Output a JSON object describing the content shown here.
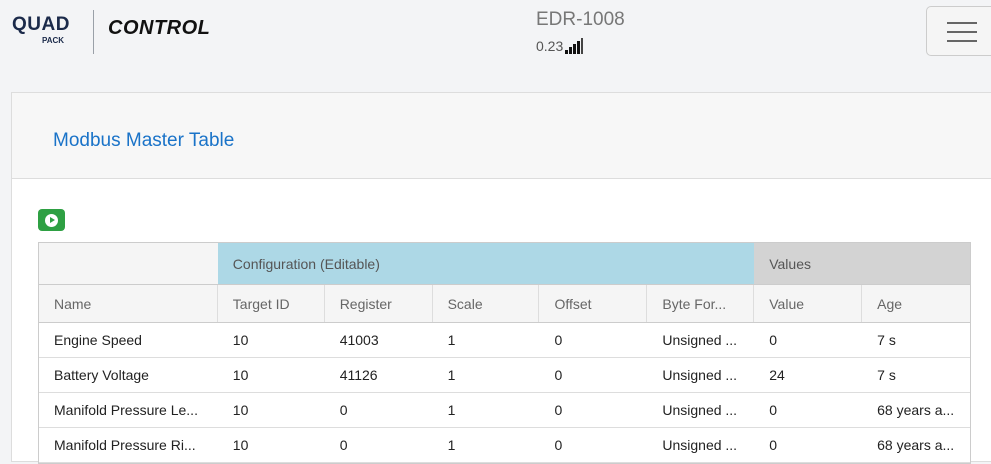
{
  "brand": {
    "quad": "QUAD",
    "pack": "PACK",
    "control": "CONTROL"
  },
  "device": {
    "name": "EDR-1008",
    "signal_value": "0.23"
  },
  "card": {
    "title": "Modbus Master Table"
  },
  "table": {
    "groups": {
      "configuration": "Configuration (Editable)",
      "values": "Values"
    },
    "columns": [
      "Name",
      "Target ID",
      "Register",
      "Scale",
      "Offset",
      "Byte For...",
      "Value",
      "Age"
    ],
    "rows": [
      [
        "Engine Speed",
        "10",
        "41003",
        "1",
        "0",
        "Unsigned ...",
        "0",
        "7 s"
      ],
      [
        "Battery Voltage",
        "10",
        "41126",
        "1",
        "0",
        "Unsigned ...",
        "24",
        "7 s"
      ],
      [
        "Manifold Pressure Le...",
        "10",
        "0",
        "1",
        "0",
        "Unsigned ...",
        "0",
        "68 years a..."
      ],
      [
        "Manifold Pressure Ri...",
        "10",
        "0",
        "1",
        "0",
        "Unsigned ...",
        "0",
        "68 years a..."
      ]
    ]
  },
  "icons": {
    "play": "play-icon",
    "menu": "hamburger-menu-icon",
    "signal": "signal-strength-icon"
  },
  "colors": {
    "accent": "#1a73c8",
    "config_header": "#add8e6",
    "values_header": "#d3d3d3",
    "play_button": "#2ea043"
  }
}
